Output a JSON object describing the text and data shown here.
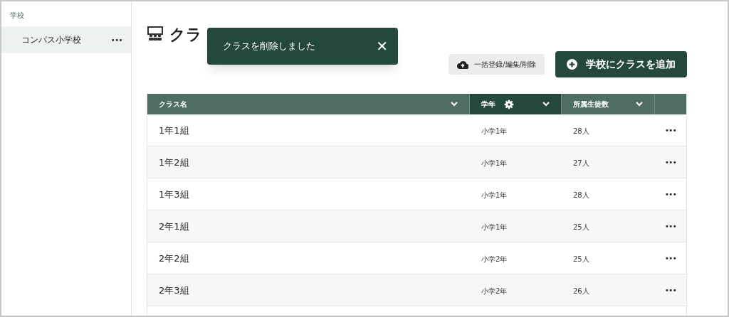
{
  "sidebar": {
    "heading": "学校",
    "items": [
      {
        "label": "コンパス小学校",
        "selected": true,
        "menu": "•••"
      }
    ]
  },
  "page_title": "クラ",
  "toast": {
    "message": "クラスを削除しました",
    "close": "✕"
  },
  "buttons": [
    {
      "kind": "secondary",
      "label": "一括登録/編集/削除"
    },
    {
      "kind": "primary",
      "label": "学校にクラスを追加"
    }
  ],
  "table": {
    "columns": [
      {
        "label": "クラス名",
        "selected": false,
        "settings": false
      },
      {
        "label": "学年",
        "selected": true,
        "settings": true
      },
      {
        "label": "所属生徒数",
        "selected": false,
        "settings": false
      }
    ],
    "rows": [
      {
        "name": "1年1組",
        "grade": "小学1年",
        "count": "28人",
        "menu": "•••"
      },
      {
        "name": "1年2組",
        "grade": "小学1年",
        "count": "27人",
        "menu": "•••"
      },
      {
        "name": "1年3組",
        "grade": "小学1年",
        "count": "28人",
        "menu": "•••"
      },
      {
        "name": "2年1組",
        "grade": "小学1年",
        "count": "25人",
        "menu": "•••"
      },
      {
        "name": "2年2組",
        "grade": "小学2年",
        "count": "25人",
        "menu": "•••"
      },
      {
        "name": "2年3組",
        "grade": "小学2年",
        "count": "26人",
        "menu": "•••"
      }
    ]
  }
}
